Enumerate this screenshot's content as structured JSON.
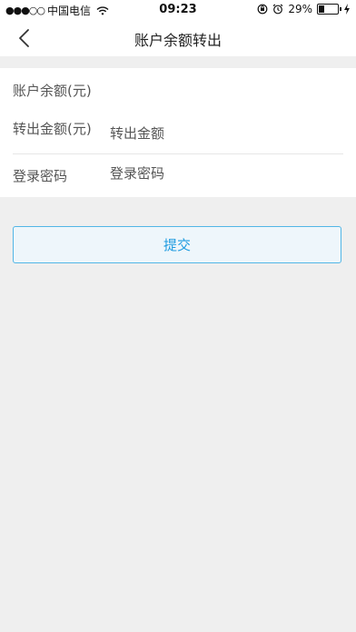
{
  "status_bar": {
    "signal": "●●●○○",
    "carrier": "中国电信",
    "time": "09:23",
    "battery": "29%",
    "battery_level": 0.29
  },
  "nav": {
    "title": "账户余额转出"
  },
  "form": {
    "balance_label": "账户余额(元)",
    "amount_label": "转出金额(元)",
    "amount_placeholder": "转出金额",
    "password_label": "登录密码",
    "password_placeholder": "登录密码"
  },
  "actions": {
    "submit_label": "提交"
  },
  "colors": {
    "accent": "#1e9be0",
    "border_accent": "#52b6e6",
    "background": "#efefef"
  }
}
